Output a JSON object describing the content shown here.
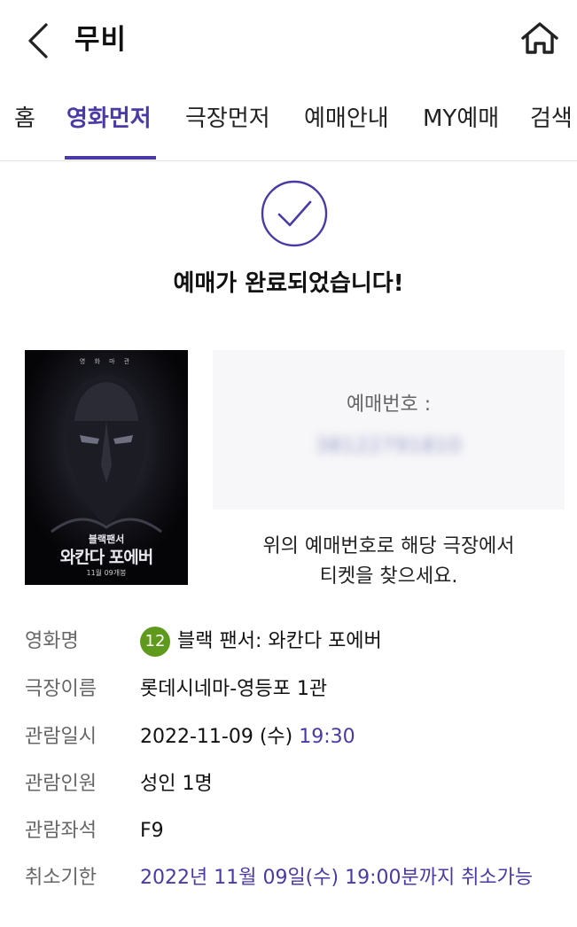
{
  "header": {
    "title": "무비",
    "back_icon": "chevron-left-icon",
    "home_icon": "home-icon"
  },
  "tabs": [
    {
      "label": "홈",
      "active": false
    },
    {
      "label": "영화먼저",
      "active": true
    },
    {
      "label": "극장먼저",
      "active": false
    },
    {
      "label": "예매안내",
      "active": false
    },
    {
      "label": "MY예매",
      "active": false
    },
    {
      "label": "검색",
      "active": false
    }
  ],
  "completion": {
    "icon": "check-circle-icon",
    "title": "예매가 완료되었습니다!"
  },
  "poster": {
    "top_text": "영 화 마 관",
    "title_small": "블랙팬서",
    "title_large": "와칸다 포에버",
    "release": "11월 09개봉"
  },
  "booking": {
    "label": "예매번호 :",
    "number": "38122791810"
  },
  "guide": {
    "line1": "위의 예매번호로 해당 극장에서",
    "line2": "티켓을 찾으세요."
  },
  "details": {
    "movie_label": "영화명",
    "rating": "12",
    "movie_title": "블랙 팬서: 와칸다 포에버",
    "theater_label": "극장이름",
    "theater": "롯데시네마-영등포 1관",
    "date_label": "관람일시",
    "date": "2022-11-09 (수)",
    "time": "19:30",
    "people_label": "관람인원",
    "people": "성인 1명",
    "seat_label": "관람좌석",
    "seat": "F9",
    "cancel_label": "취소기한",
    "cancel": "2022년 11월 09일(수) 19:00분까지 취소가능"
  },
  "colors": {
    "accent": "#4b3aa6",
    "rating_badge": "#5f9a1c",
    "label_gray": "#666666"
  }
}
